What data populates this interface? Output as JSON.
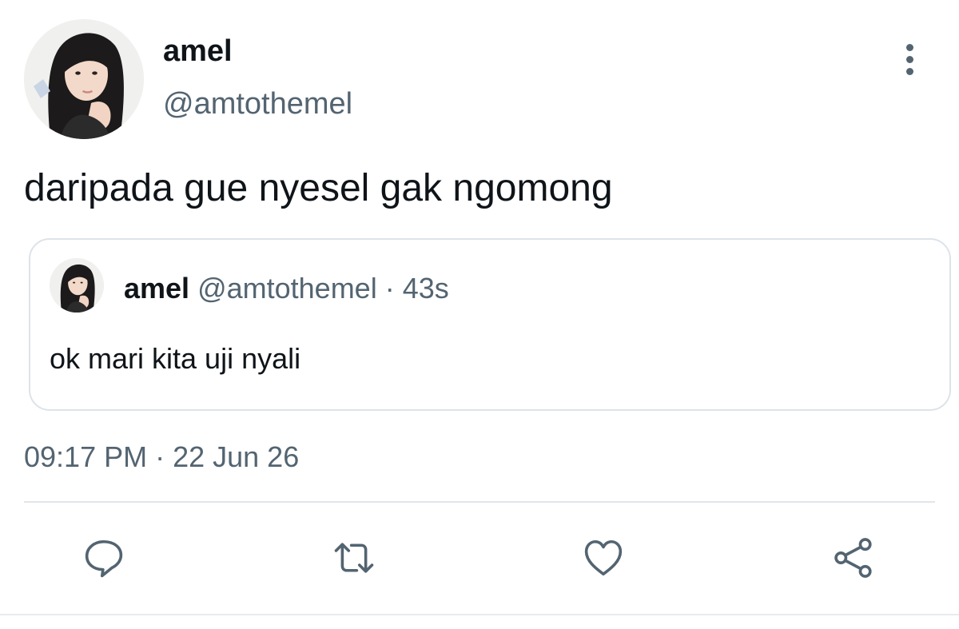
{
  "tweet": {
    "author": {
      "display_name": "amel",
      "handle": "@amtothemel"
    },
    "text": "daripada gue nyesel gak ngomong",
    "quoted": {
      "display_name": "amel",
      "meta": " @amtothemel · 43s",
      "text": "ok mari kita uji nyali"
    },
    "timestamp": "09:17 PM · 22 Jun 26",
    "actions": [
      {
        "name": "reply",
        "icon": "speech-bubble-icon"
      },
      {
        "name": "retweet",
        "icon": "retweet-arrows-icon"
      },
      {
        "name": "like",
        "icon": "heart-icon"
      },
      {
        "name": "share",
        "icon": "share-nodes-icon"
      }
    ]
  },
  "colors": {
    "text_primary": "#0f1419",
    "text_secondary": "#536471",
    "border": "#dde3e8",
    "icon": "#536471"
  }
}
